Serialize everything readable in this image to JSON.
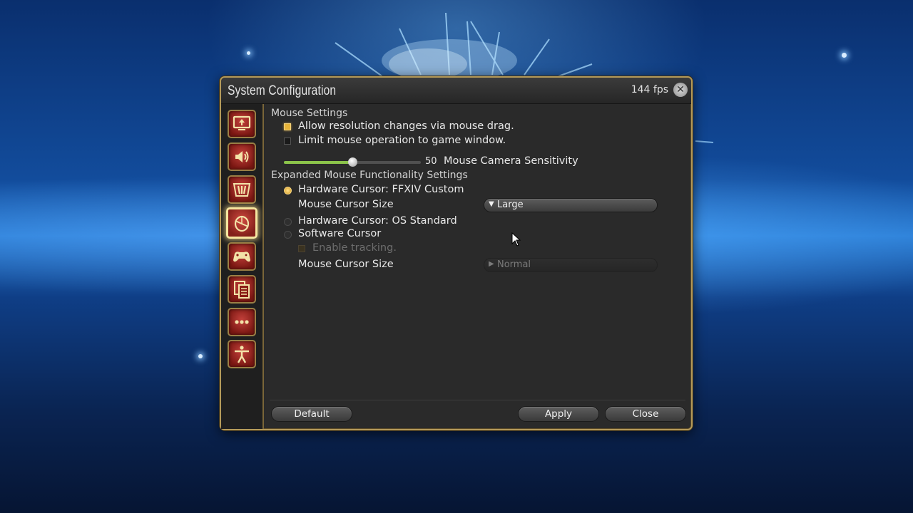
{
  "window": {
    "title": "System Configuration",
    "fps": "144 fps"
  },
  "sidebar": {
    "items": [
      {
        "name": "display-settings",
        "icon": "monitor-icon",
        "active": false
      },
      {
        "name": "sound-settings",
        "icon": "speaker-icon",
        "active": false
      },
      {
        "name": "other-settings",
        "icon": "gauge-icon",
        "active": false
      },
      {
        "name": "mouse-settings",
        "icon": "mouse-icon",
        "active": true
      },
      {
        "name": "gamepad-settings",
        "icon": "gamepad-icon",
        "active": false
      },
      {
        "name": "log-settings",
        "icon": "document-icon",
        "active": false
      },
      {
        "name": "misc-settings",
        "icon": "ellipsis-icon",
        "active": false
      },
      {
        "name": "accessibility-settings",
        "icon": "person-icon",
        "active": false
      }
    ]
  },
  "mouse_settings": {
    "header": "Mouse Settings",
    "allow_resolution": {
      "label": "Allow resolution changes via mouse drag.",
      "checked": true
    },
    "limit_mouse": {
      "label": "Limit mouse operation to game window.",
      "checked": false
    },
    "sensitivity": {
      "value": "50",
      "label": "Mouse Camera Sensitivity",
      "fraction": 0.5
    }
  },
  "expanded": {
    "header": "Expanded Mouse Functionality Settings",
    "hw_custom": {
      "label": "Hardware Cursor: FFXIV Custom",
      "selected": true
    },
    "cursor_size_label": "Mouse Cursor Size",
    "cursor_size_value": "Large",
    "hw_os": {
      "label": "Hardware Cursor: OS Standard",
      "selected": false
    },
    "software": {
      "label": "Software Cursor",
      "selected": false
    },
    "tracking": {
      "label": "Enable tracking.",
      "checked": false
    },
    "cursor_size_label2": "Mouse Cursor Size",
    "cursor_size_value2": "Normal"
  },
  "footer": {
    "default_label": "Default",
    "apply_label": "Apply",
    "close_label": "Close"
  },
  "colors": {
    "accent": "#e7b43a",
    "frame": "#b49a5a",
    "slider_fill": "#8bc34a"
  }
}
